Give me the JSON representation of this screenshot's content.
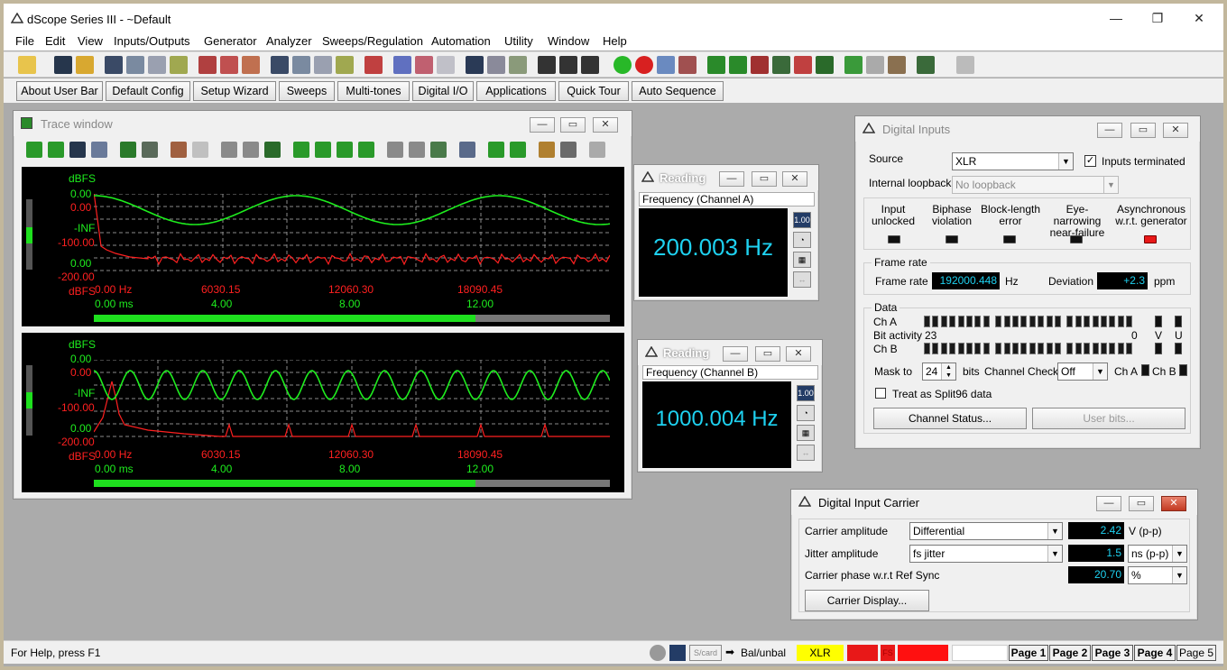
{
  "app": {
    "title": "dScope Series III - ~Default"
  },
  "menu": [
    "File",
    "Edit",
    "View",
    "Inputs/Outputs",
    "Generator",
    "Analyzer",
    "Sweeps/Regulation",
    "Automation",
    "Utility",
    "Window",
    "Help"
  ],
  "user_bar": [
    "About User Bar",
    "Default Config",
    "Setup Wizard",
    "Sweeps",
    "Multi-tones",
    "Digital I/O",
    "Applications",
    "Quick Tour",
    "Auto Sequence"
  ],
  "trace": {
    "title": "Trace window",
    "p1": {
      "ylabels": [
        "dBFS",
        "0.00",
        "0.00",
        "-INF",
        "-100.00",
        "0.00",
        "-200.00",
        "dBFS"
      ],
      "xfreq": [
        "0.00 Hz",
        "6030.15",
        "12060.30",
        "18090.45"
      ],
      "xtime": [
        "0.00 ms",
        "4.00",
        "8.00",
        "12.00"
      ],
      "progress": 0.74
    },
    "p2": {
      "ylabels": [
        "dBFS",
        "0.00",
        "0.00",
        "-INF",
        "-100.00",
        "0.00",
        "-200.00",
        "dBFS"
      ],
      "xfreq": [
        "0.00 Hz",
        "6030.15",
        "12060.30",
        "18090.45"
      ],
      "xtime": [
        "0.00 ms",
        "4.00",
        "8.00",
        "12.00"
      ],
      "progress": 0.74
    }
  },
  "reading_a": {
    "title": "Reading",
    "label": "Frequency (Channel A)",
    "value": "200.003 Hz"
  },
  "reading_b": {
    "title": "Reading",
    "label": "Frequency (Channel B)",
    "value": "1000.004 Hz"
  },
  "digital_inputs": {
    "title": "Digital Inputs",
    "source_label": "Source",
    "source_value": "XLR",
    "terminated_label": "Inputs terminated",
    "loopback_label": "Internal loopback",
    "loopback_value": "No loopback",
    "status": [
      {
        "l1": "Input",
        "l2": "unlocked",
        "on": false
      },
      {
        "l1": "Biphase",
        "l2": "violation",
        "on": false
      },
      {
        "l1": "Block-length",
        "l2": "error",
        "on": false
      },
      {
        "l1": "Eye-narrowing",
        "l2": "near-failure",
        "on": false
      },
      {
        "l1": "Asynchronous",
        "l2": "w.r.t. generator",
        "on": true
      }
    ],
    "frame_rate_group": "Frame rate",
    "frame_rate_label": "Frame rate",
    "frame_rate_value": "192000.448",
    "frame_rate_unit": "Hz",
    "deviation_label": "Deviation",
    "deviation_value": "+2.3",
    "deviation_unit": "ppm",
    "data_group": "Data",
    "cha": "Ch A",
    "bit_activity": "Bit activity",
    "chb": "Ch B",
    "bit_hi": "23",
    "bit_lo": "0",
    "v": "V",
    "u": "U",
    "mask_label": "Mask to",
    "mask_value": "24",
    "bits_label": "bits",
    "channel_check_label": "Channel Check",
    "channel_check_value": "Off",
    "cha_short": "Ch A",
    "chb_short": "Ch B",
    "split96": "Treat as Split96 data",
    "channel_status_btn": "Channel Status...",
    "user_bits_btn": "User bits..."
  },
  "carrier": {
    "title": "Digital Input Carrier",
    "amp_label": "Carrier amplitude",
    "amp_mode": "Differential",
    "amp_value": "2.42",
    "amp_unit": "V (p-p)",
    "jitter_label": "Jitter amplitude",
    "jitter_mode": "fs jitter",
    "jitter_value": "1.5",
    "jitter_unit": "ns (p-p)",
    "phase_label": "Carrier phase w.r.t Ref Sync",
    "phase_value": "20.70",
    "phase_unit": "%",
    "display_btn": "Carrier Display..."
  },
  "status": {
    "help": "For Help, press F1",
    "card": "S/card",
    "balunbal": "Bal/unbal",
    "xlr": "XLR",
    "fs": "FS",
    "pages": [
      "Page 1",
      "Page 2",
      "Page 3",
      "Page 4",
      "Page 5"
    ]
  },
  "colors": {
    "trace_green": "#1eed1e",
    "trace_red": "#ff2020",
    "reading_cyan": "#1ed1f0"
  }
}
